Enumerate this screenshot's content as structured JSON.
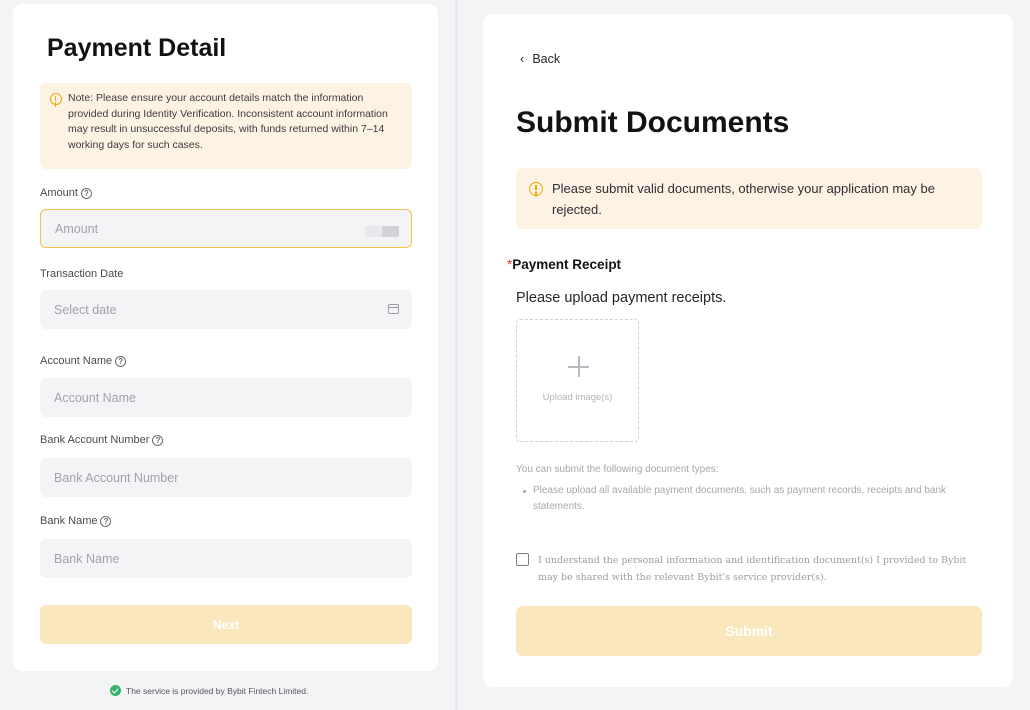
{
  "payment_detail": {
    "title": "Payment Detail",
    "note": "Note: Please ensure your account details match the information provided during Identity Verification. Inconsistent account information may result in unsuccessful deposits, with funds returned within 7–14 working days for such cases.",
    "fields": {
      "amount": {
        "label": "Amount",
        "placeholder": "Amount",
        "icon": "help-circle-icon"
      },
      "transaction_date": {
        "label": "Transaction Date",
        "placeholder": "Select date",
        "icon": "calendar-icon"
      },
      "account_name": {
        "label": "Account Name",
        "placeholder": "Account Name",
        "icon": "help-circle-icon"
      },
      "bank_account_number": {
        "label": "Bank Account Number",
        "placeholder": "Bank Account Number",
        "icon": "help-circle-icon"
      },
      "bank_name": {
        "label": "Bank Name",
        "placeholder": "Bank Name",
        "icon": "help-circle-icon"
      }
    },
    "next_label": "Next",
    "service_note": "The service is provided by Bybit Fintech Limited."
  },
  "submit_documents": {
    "back_label": "Back",
    "title": "Submit Documents",
    "warning": "Please submit valid documents, otherwise your application may be rejected.",
    "receipt": {
      "required_mark": "*",
      "title": "Payment Receipt",
      "subtitle": "Please upload payment receipts.",
      "upload_label": "Upload image(s)"
    },
    "doc_types_intro": "You can submit the following document types:",
    "doc_types": [
      "Please upload all available payment documents, such as payment records, receipts and bank statements."
    ],
    "agreement": "I understand the personal information and identification document(s) I provided to Bybit may be shared with the relevant Bybit's service provider(s).",
    "submit_label": "Submit"
  },
  "colors": {
    "accent": "#f4bf4f",
    "button_disabled": "#fbe7bd",
    "notice_bg": "#fdf3e4",
    "warning_icon": "#f0a500",
    "required": "#e0303b",
    "success": "#34b46a"
  }
}
